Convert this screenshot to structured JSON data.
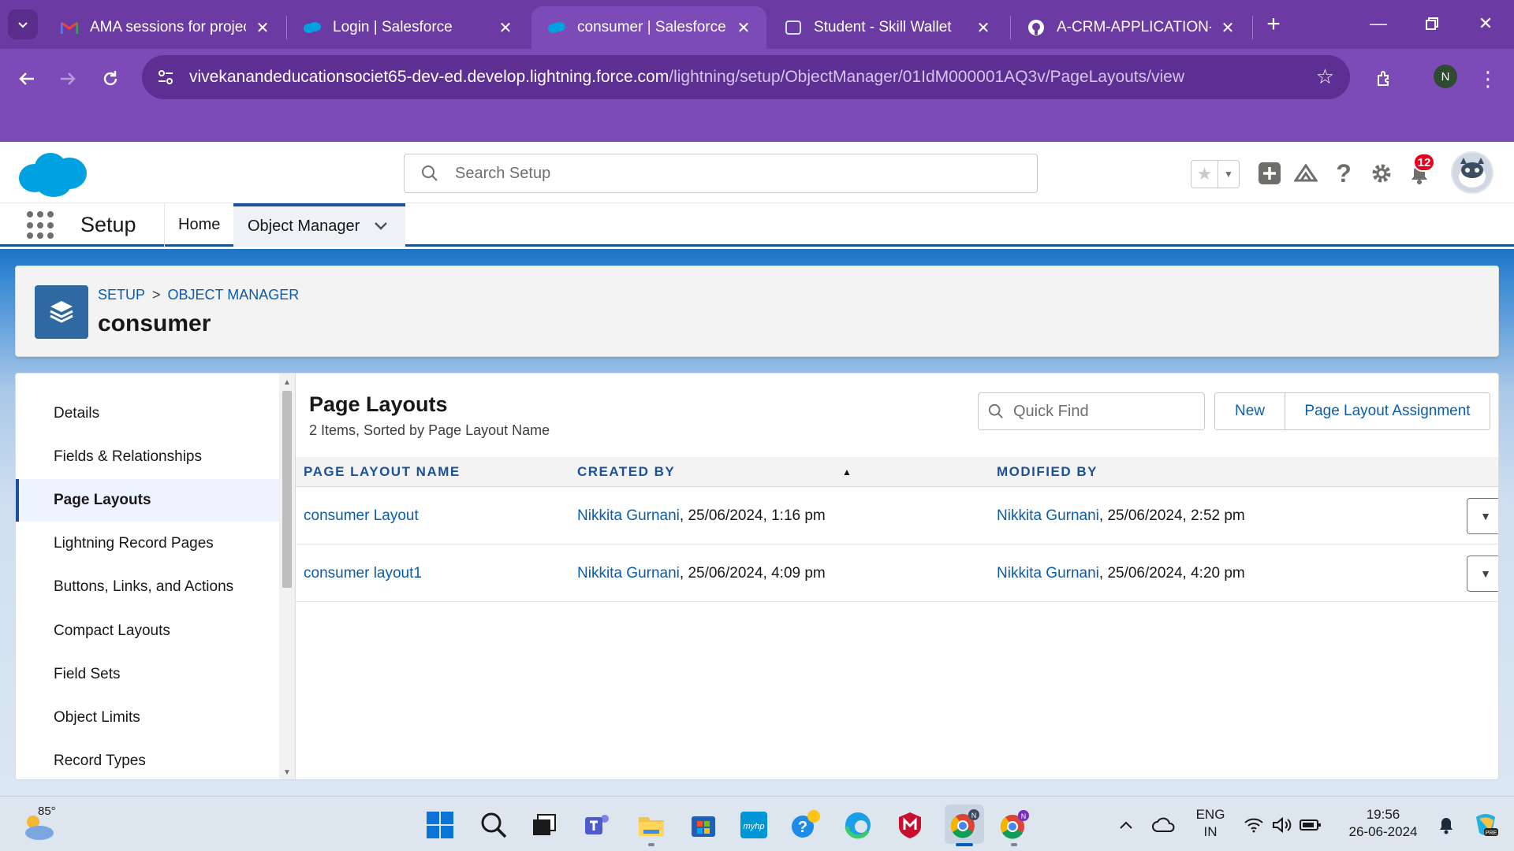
{
  "browser": {
    "tabs": [
      {
        "title": "AMA sessions for project",
        "icon": "gmail-icon"
      },
      {
        "title": "Login | Salesforce",
        "icon": "salesforce-cloud-icon"
      },
      {
        "title": "consumer | Salesforce",
        "icon": "salesforce-cloud-icon",
        "active": true
      },
      {
        "title": "Student - Skill Wallet",
        "icon": "skill-wallet-icon"
      },
      {
        "title": "A-CRM-APPLICATION-FO",
        "icon": "github-icon"
      }
    ],
    "url_host": "vivekanandeducationsociet65-dev-ed.develop.lightning.force.com",
    "url_path": "/lightning/setup/ObjectManager/01IdM000001AQ3v/PageLayouts/view",
    "profile_initial": "N",
    "theme_color": "#7d4bb8"
  },
  "header": {
    "search_placeholder": "Search Setup",
    "notification_count": "12"
  },
  "nav": {
    "app_name": "Setup",
    "items": [
      {
        "label": "Home"
      },
      {
        "label": "Object Manager",
        "active": true
      }
    ]
  },
  "page": {
    "breadcrumb": [
      "SETUP",
      "OBJECT MANAGER"
    ],
    "title": "consumer"
  },
  "sidebar": {
    "items": [
      {
        "label": "Details"
      },
      {
        "label": "Fields & Relationships"
      },
      {
        "label": "Page Layouts",
        "active": true
      },
      {
        "label": "Lightning Record Pages"
      },
      {
        "label": "Buttons, Links, and Actions"
      },
      {
        "label": "Compact Layouts"
      },
      {
        "label": "Field Sets"
      },
      {
        "label": "Object Limits"
      },
      {
        "label": "Record Types"
      }
    ]
  },
  "main": {
    "title": "Page Layouts",
    "subtitle": "2 Items, Sorted by Page Layout Name",
    "quick_find_placeholder": "Quick Find",
    "buttons": {
      "new": "New",
      "assignment": "Page Layout Assignment"
    },
    "columns": [
      "PAGE LAYOUT NAME",
      "CREATED BY",
      "MODIFIED BY"
    ],
    "rows": [
      {
        "name": "consumer Layout",
        "created_user": "Nikkita Gurnani",
        "created_date": ", 25/06/2024, 1:16 pm",
        "modified_user": "Nikkita Gurnani",
        "modified_date": ", 25/06/2024, 2:52 pm"
      },
      {
        "name": "consumer layout1",
        "created_user": "Nikkita Gurnani",
        "created_date": ", 25/06/2024, 4:09 pm",
        "modified_user": "Nikkita Gurnani",
        "modified_date": ", 25/06/2024, 4:20 pm"
      }
    ]
  },
  "taskbar": {
    "temperature": "85°",
    "language": "ENG",
    "region": "IN",
    "time": "19:56",
    "date": "26-06-2024"
  }
}
